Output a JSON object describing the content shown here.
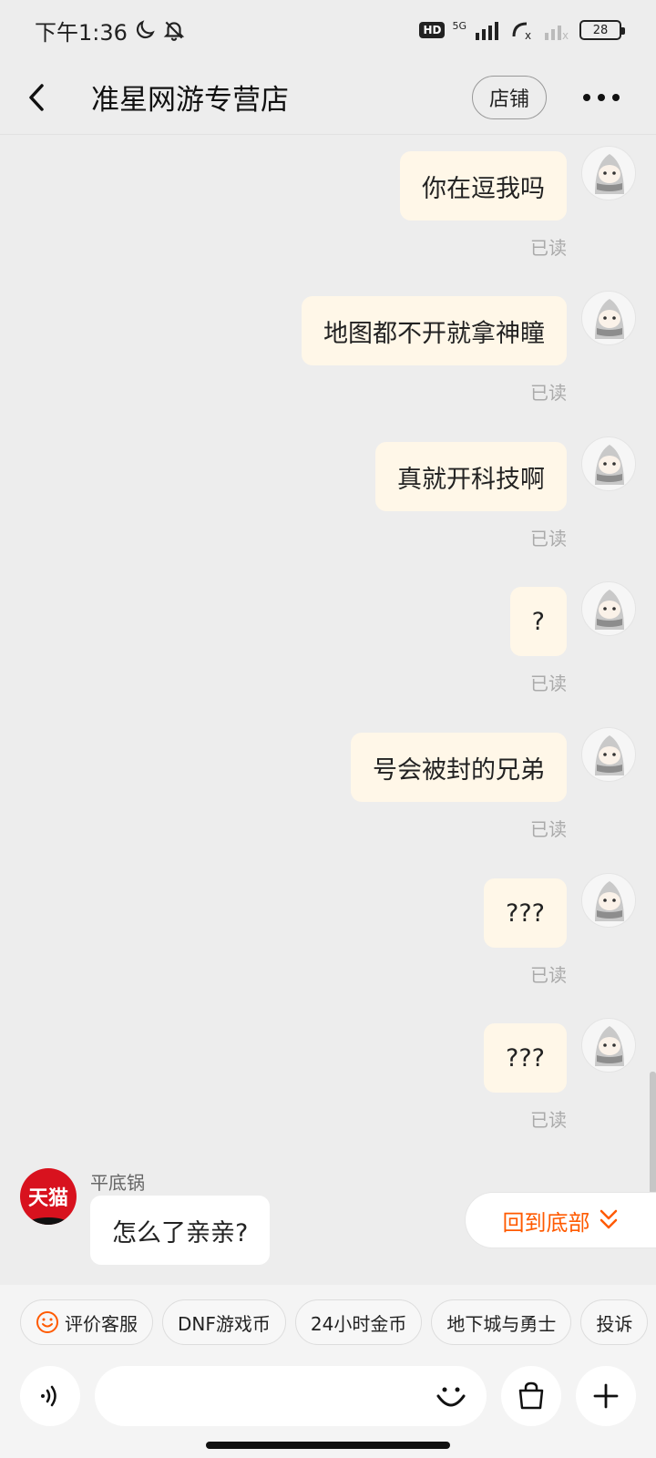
{
  "status_bar": {
    "time": "下午1:36",
    "network_type": "5G",
    "hd_label": "HD",
    "battery": "28"
  },
  "header": {
    "title": "准星网游专营店",
    "shop_button": "店铺"
  },
  "messages": [
    {
      "text": "你在逗我吗",
      "status": "已读"
    },
    {
      "text": "地图都不开就拿神瞳",
      "status": "已读"
    },
    {
      "text": "真就开科技啊",
      "status": "已读"
    },
    {
      "text": "?",
      "status": "已读"
    },
    {
      "text": "号会被封的兄弟",
      "status": "已读"
    },
    {
      "text": "???",
      "status": "已读"
    },
    {
      "text": "???",
      "status": "已读"
    }
  ],
  "shop_message": {
    "avatar_text": "天猫",
    "sender": "平底锅",
    "text": "怎么了亲亲?"
  },
  "back_to_bottom": "回到底部",
  "quick_chips": [
    "评价客服",
    "DNF游戏币",
    "24小时金币",
    "地下城与勇士",
    "投诉"
  ],
  "input": {
    "placeholder": ""
  },
  "colors": {
    "accent": "#ff5a00",
    "sent_bubble": "#fff7e8",
    "background": "#ededed"
  }
}
